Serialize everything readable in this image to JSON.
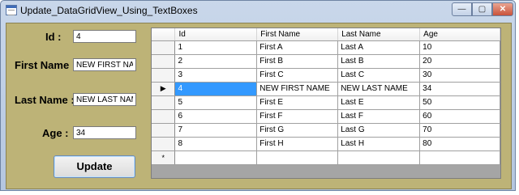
{
  "window": {
    "title": "Update_DataGridView_Using_TextBoxes",
    "icon": "form-icon",
    "controls": {
      "minimize": "—",
      "maximize": "▢",
      "close": "✕"
    }
  },
  "form": {
    "id_label": "Id :",
    "first_name_label": "First Name :",
    "last_name_label": "Last Name :",
    "age_label": "Age :",
    "id_value": "4",
    "first_name_value": "NEW FIRST NAME",
    "last_name_value": "NEW LAST NAME",
    "age_value": "34",
    "update_label": "Update",
    "colors": {
      "background": "#bdb377",
      "selection": "#3399ff"
    }
  },
  "grid": {
    "columns": [
      "Id",
      "First Name",
      "Last Name",
      "Age"
    ],
    "rows": [
      [
        "1",
        "First A",
        "Last A",
        "10"
      ],
      [
        "2",
        "First B",
        "Last B",
        "20"
      ],
      [
        "3",
        "First C",
        "Last C",
        "30"
      ],
      [
        "4",
        "NEW FIRST NAME",
        "NEW LAST NAME",
        "34"
      ],
      [
        "5",
        "First E",
        "Last E",
        "50"
      ],
      [
        "6",
        "First F",
        "Last F",
        "60"
      ],
      [
        "7",
        "First G",
        "Last G",
        "70"
      ],
      [
        "8",
        "First H",
        "Last H",
        "80"
      ]
    ],
    "current_row_marker": "▶",
    "new_row_marker": "*",
    "selected_row": 3,
    "selected_column": 0
  }
}
